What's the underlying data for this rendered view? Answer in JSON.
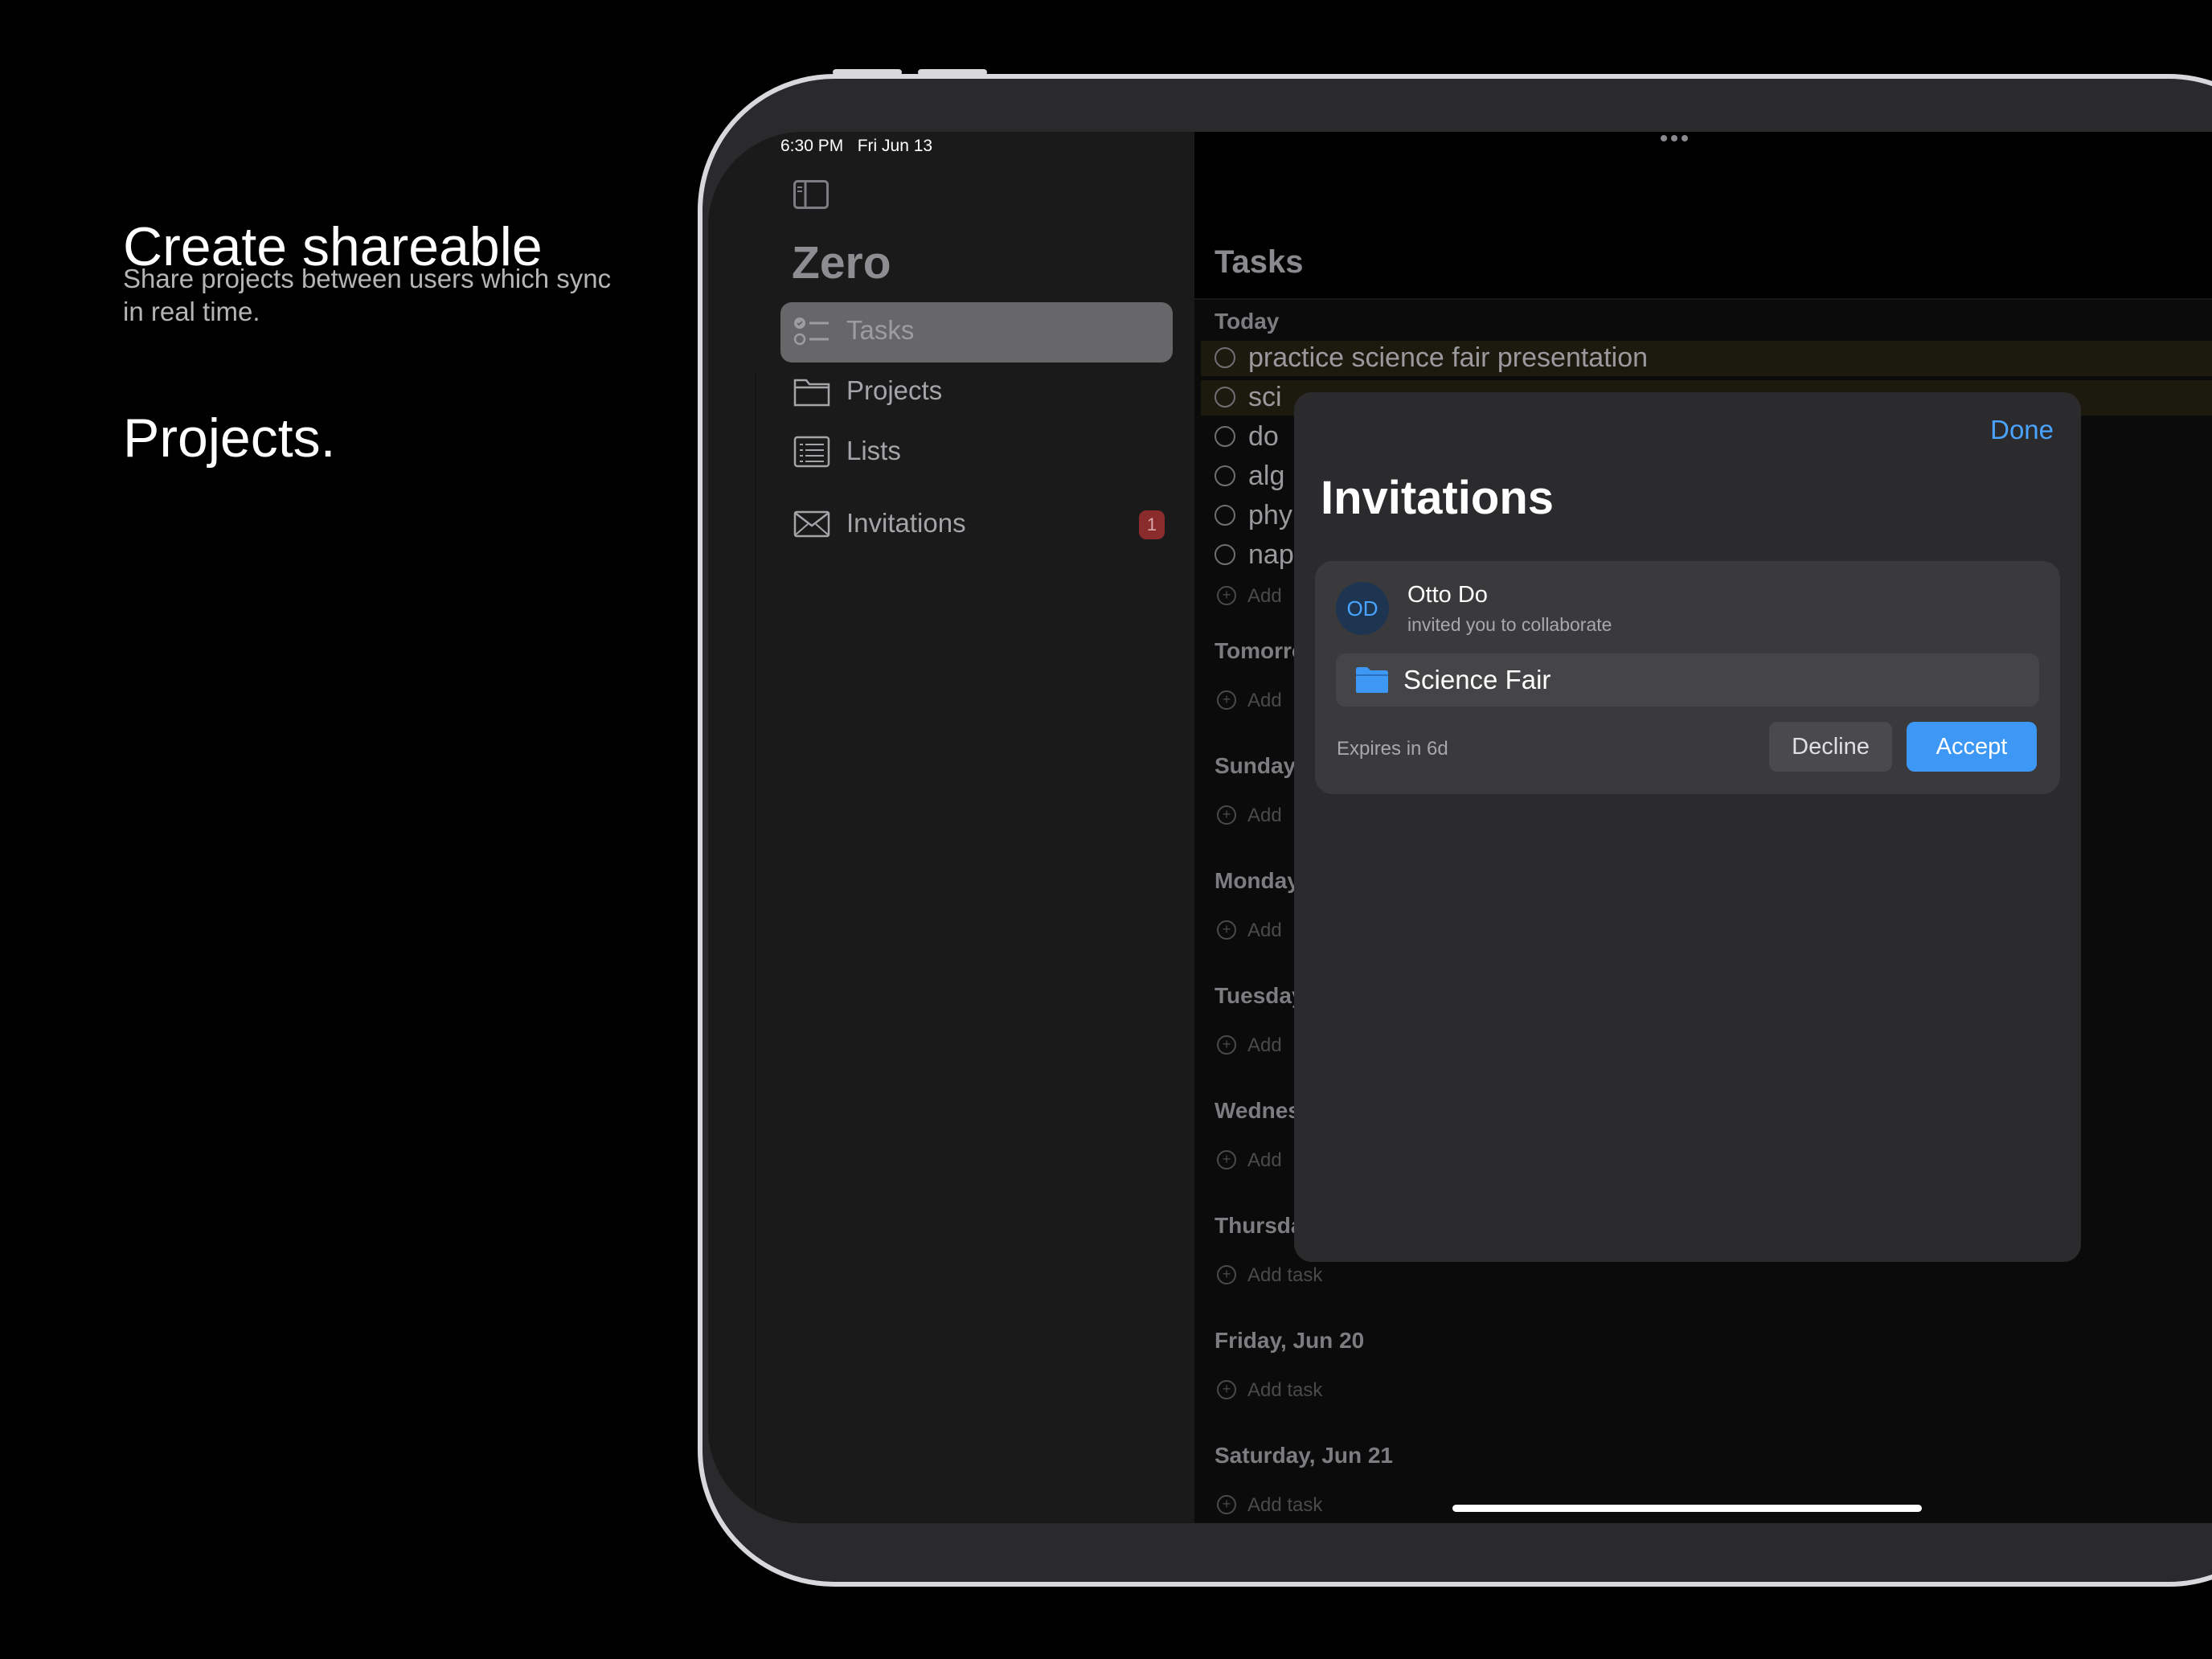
{
  "promo": {
    "title_line1": "Create shareable",
    "title_line2": "Projects.",
    "subtitle": "Share projects between users which sync in real time."
  },
  "status_bar": {
    "time": "6:30 PM",
    "date": "Fri Jun 13"
  },
  "sidebar": {
    "app_title": "Zero",
    "items": [
      {
        "label": "Tasks",
        "icon": "tasks-icon",
        "active": true
      },
      {
        "label": "Projects",
        "icon": "folder-icon",
        "active": false
      },
      {
        "label": "Lists",
        "icon": "list-icon",
        "active": false
      },
      {
        "label": "Invitations",
        "icon": "envelope-icon",
        "active": false,
        "badge": "1"
      }
    ]
  },
  "main": {
    "title": "Tasks",
    "today_label": "Today",
    "tasks": [
      "practice science fair presentation",
      "sci",
      "do",
      "alg",
      "phy",
      "nap"
    ],
    "add_label": "Add",
    "add_task_label": "Add task",
    "sections": [
      "Tomorro",
      "Sunday,",
      "Monday",
      "Tuesday",
      "Wednes",
      "Thursda",
      "Friday, Jun 20",
      "Saturday, Jun 21"
    ]
  },
  "modal": {
    "done_label": "Done",
    "title": "Invitations",
    "invitation": {
      "avatar_initials": "OD",
      "inviter": "Otto Do",
      "message": "invited you to collaborate",
      "project": "Science Fair",
      "expires": "Expires in 6d",
      "decline_label": "Decline",
      "accept_label": "Accept"
    }
  },
  "colors": {
    "accent": "#3d97f5",
    "badge": "#8b2c2c"
  }
}
